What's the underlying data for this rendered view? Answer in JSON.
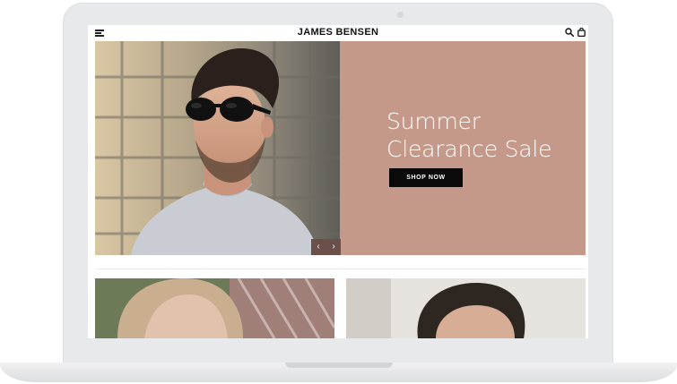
{
  "store": {
    "brand": "JAMES BENSEN"
  },
  "header": {
    "menu_icon": "hamburger-menu-icon",
    "search_icon": "search-icon",
    "cart_icon": "shopping-bag-icon"
  },
  "hero": {
    "title_line1": "Summer",
    "title_line2": "Clearance Sale",
    "cta_label": "SHOP NOW",
    "prev_label": "‹",
    "next_label": "›"
  },
  "colors": {
    "hero_panel": "#c5998a",
    "cta_background": "#0a0a0a",
    "carousel_controls": "#6a5049"
  }
}
